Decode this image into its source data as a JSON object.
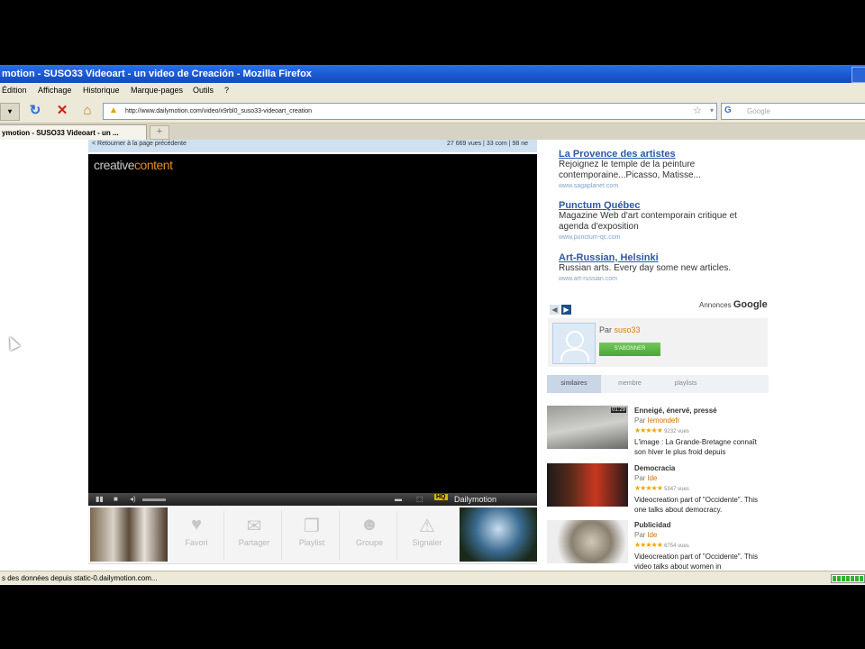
{
  "window": {
    "title": "motion - SUSO33 Videoart - un video de Creación - Mozilla Firefox"
  },
  "menu": [
    "Édition",
    "Affichage",
    "Historique",
    "Marque-pages",
    "Outils",
    "?"
  ],
  "nav": {
    "url": "http://www.dailymotion.com/video/x9rbl0_suso33-videoart_creation",
    "search_placeholder": "Google"
  },
  "tab": {
    "label": "ymotion - SUSO33 Videoart - un ...",
    "new_tab": "+"
  },
  "video": {
    "header_left": "< Retourner à la page précédente",
    "header_right": "27 669 vues | 33 com | 98 ne",
    "logo_a": "creative",
    "logo_b": "content",
    "brand": "Dailymotion",
    "hq": "HQ"
  },
  "actions": [
    {
      "label": "Favori",
      "icon": "heart-icon"
    },
    {
      "label": "Partager",
      "icon": "envelope-icon"
    },
    {
      "label": "Playlist",
      "icon": "playlist-icon"
    },
    {
      "label": "Groupe",
      "icon": "group-icon"
    },
    {
      "label": "Signaler",
      "icon": "warning-icon"
    }
  ],
  "ads": [
    {
      "title": "La Provence des artistes",
      "text": "Rejoignez le temple de la peinture contemporaine...Picasso, Matisse...",
      "url": "www.sagaplanet.com"
    },
    {
      "title": "Punctum Québec",
      "text": "Magazine Web d'art contemporain critique et agenda d'exposition",
      "url": "www.punctum-qc.com"
    },
    {
      "title": "Art-Russian, Helsinki",
      "text": "Russian arts. Every day some new articles.",
      "url": "www.art-russian.com"
    }
  ],
  "annonces": {
    "label": "Annonces",
    "brand": "Google"
  },
  "user": {
    "par": "Par",
    "name": "suso33",
    "subscribe": "S'ABONNER"
  },
  "rtabs": [
    "similaires",
    "membre",
    "playlists"
  ],
  "related": [
    {
      "title": "Enneigé, énervé, pressé",
      "by": "Par",
      "author": "lemondefr",
      "stars": "★★★★★",
      "views": "9232 vues",
      "desc": "L'image : La Grande-Bretagne connaît son hiver le plus froid depuis",
      "dur": "01:29"
    },
    {
      "title": "Democracia",
      "by": "Par",
      "author": "lde",
      "stars": "★★★★★",
      "views": "5347 vues",
      "desc": "Videocreation part of \"Occidente\". This one talks about democracy.",
      "dur": ""
    },
    {
      "title": "Publicidad",
      "by": "Par",
      "author": "lde",
      "stars": "★★★★★",
      "views": "6754 vues",
      "desc": "Videocreation part of \"Occidente\". This video talks about women in",
      "dur": ""
    }
  ],
  "status": {
    "text": "s des données depuis static-0.dailymotion.com..."
  },
  "colors": {
    "titlebar": "#1a57d0",
    "link": "#2b5aa8",
    "accent": "#e58a1e",
    "subscribe": "#47a536"
  }
}
